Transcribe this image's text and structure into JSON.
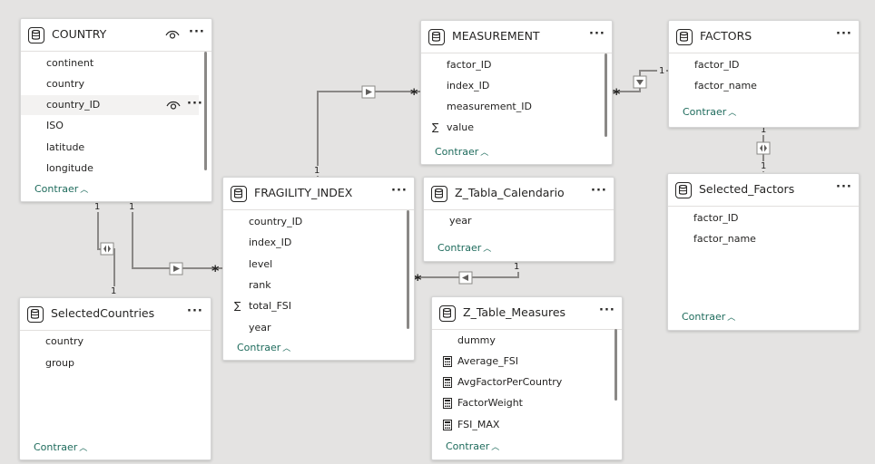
{
  "ui": {
    "more_label": "···",
    "collapse_label": "Contraer",
    "rel_one": "1",
    "rel_many": "*"
  },
  "tables": {
    "country": {
      "title": "COUNTRY",
      "fields": [
        "continent",
        "country",
        "country_ID",
        "ISO",
        "latitude",
        "longitude"
      ]
    },
    "measurement": {
      "title": "MEASUREMENT",
      "fields": [
        "factor_ID",
        "index_ID",
        "measurement_ID",
        "value"
      ]
    },
    "factors": {
      "title": "FACTORS",
      "fields": [
        "factor_ID",
        "factor_name"
      ]
    },
    "fragility_index": {
      "title": "FRAGILITY_INDEX",
      "fields": [
        "country_ID",
        "index_ID",
        "level",
        "rank",
        "total_FSI",
        "year"
      ]
    },
    "z_tabla_calendario": {
      "title": "Z_Tabla_Calendario",
      "fields": [
        "year"
      ]
    },
    "selected_factors": {
      "title": "Selected_Factors",
      "fields": [
        "factor_ID",
        "factor_name"
      ]
    },
    "selected_countries": {
      "title": "SelectedCountries",
      "fields": [
        "country",
        "group"
      ]
    },
    "z_table_measures": {
      "title": "Z_Table_Measures",
      "fields": [
        "dummy",
        "Average_FSI",
        "AvgFactorPerCountry",
        "FactorWeight",
        "FSI_MAX"
      ]
    }
  },
  "icons": {
    "table": "database-icon",
    "visibility": "eye-icon",
    "sum": "sigma-icon",
    "measure": "calculator-icon",
    "more": "more-options-icon",
    "collapse": "chevron-up-icon"
  },
  "colors": {
    "canvas": "#e4e3e2",
    "card": "#ffffff",
    "collapse_link": "#1e6b5c",
    "relationship_line": "#8a8886"
  }
}
